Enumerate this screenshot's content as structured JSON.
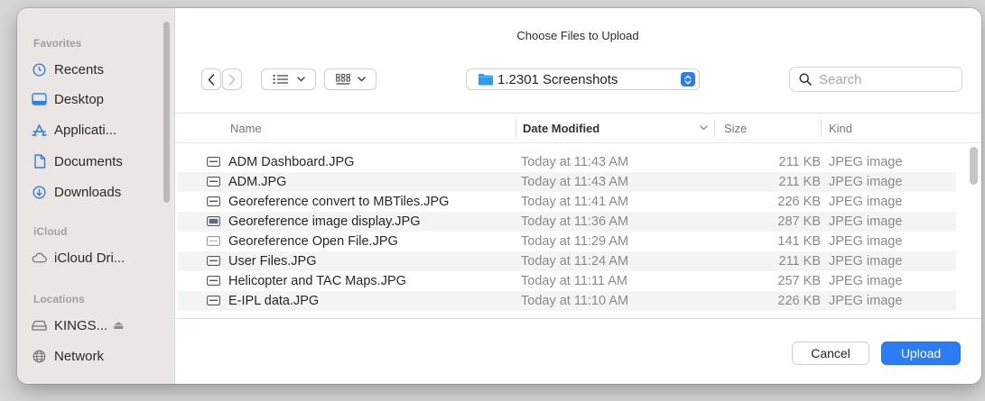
{
  "dialog": {
    "title": "Choose Files to Upload"
  },
  "sidebar": {
    "favorites_label": "Favorites",
    "favorites": [
      {
        "label": "Recents",
        "icon": "clock-icon"
      },
      {
        "label": "Desktop",
        "icon": "desktop-icon"
      },
      {
        "label": "Applicati...",
        "icon": "applications-icon"
      },
      {
        "label": "Documents",
        "icon": "document-icon"
      },
      {
        "label": "Downloads",
        "icon": "download-icon"
      }
    ],
    "icloud_label": "iCloud",
    "icloud": [
      {
        "label": "iCloud Dri...",
        "icon": "cloud-icon"
      }
    ],
    "locations_label": "Locations",
    "locations": [
      {
        "label": "KINGS...",
        "icon": "drive-icon",
        "eject": "⏏"
      },
      {
        "label": "Network",
        "icon": "globe-icon"
      }
    ]
  },
  "toolbar": {
    "back_icon": "chevron-left-icon",
    "forward_icon": "chevron-right-icon",
    "list_view_icon": "list-view-icon",
    "grid_view_icon": "grid-view-icon",
    "location": "1.2301 Screenshots",
    "search_placeholder": "Search"
  },
  "columns": {
    "name": "Name",
    "date": "Date Modified",
    "size": "Size",
    "kind": "Kind"
  },
  "files": [
    {
      "name": "ADM Dashboard.JPG",
      "date": "Today at 11:43 AM",
      "size": "211 KB",
      "kind": "JPEG image"
    },
    {
      "name": "ADM.JPG",
      "date": "Today at 11:43 AM",
      "size": "211 KB",
      "kind": "JPEG image"
    },
    {
      "name": "Georeference convert to MBTiles.JPG",
      "date": "Today at 11:41 AM",
      "size": "226 KB",
      "kind": "JPEG image"
    },
    {
      "name": "Georeference image display.JPG",
      "date": "Today at 11:36 AM",
      "size": "287 KB",
      "kind": "JPEG image"
    },
    {
      "name": "Georeference Open File.JPG",
      "date": "Today at 11:29 AM",
      "size": "141 KB",
      "kind": "JPEG image"
    },
    {
      "name": "User Files.JPG",
      "date": "Today at 11:24 AM",
      "size": "211 KB",
      "kind": "JPEG image"
    },
    {
      "name": "Helicopter and TAC Maps.JPG",
      "date": "Today at 11:11 AM",
      "size": "257 KB",
      "kind": "JPEG image"
    },
    {
      "name": "E-IPL data.JPG",
      "date": "Today at 11:10 AM",
      "size": "226 KB",
      "kind": "JPEG image"
    }
  ],
  "footer": {
    "cancel": "Cancel",
    "upload": "Upload"
  },
  "colors": {
    "accent": "#2b7cf6",
    "sidebar": "#ebe6e4",
    "folder": "#2e9bf0"
  }
}
